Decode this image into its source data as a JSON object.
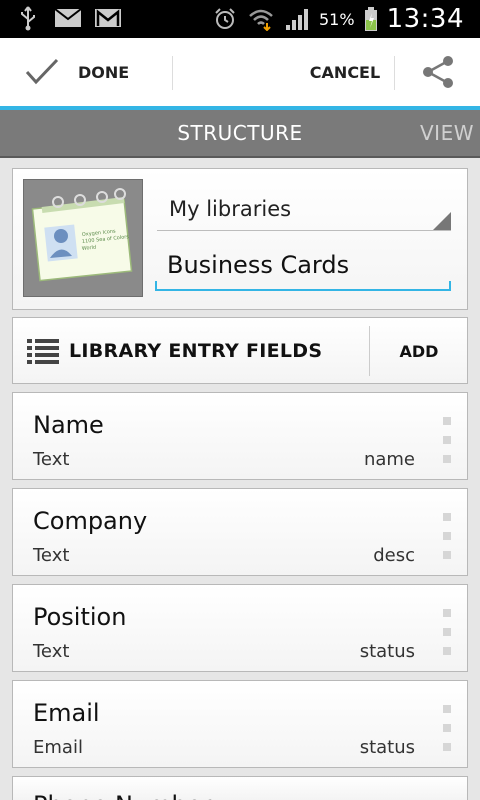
{
  "status_bar": {
    "icons": [
      "usb-icon",
      "mail-icon",
      "gmail-icon",
      "alarm-icon",
      "wifi-icon",
      "signal-icon",
      "battery-icon"
    ],
    "battery": "51%",
    "time": "13:34"
  },
  "action_bar": {
    "done_label": "DONE",
    "cancel_label": "CANCEL",
    "accent_color": "#33b5e5"
  },
  "tabs": {
    "structure": "STRUCTURE",
    "view": "VIEW"
  },
  "library": {
    "selected": "My libraries",
    "name_value": "Business Cards",
    "thumbnail_text": "Oxygen Icons 1100 Sea of Colors World"
  },
  "fields_header": {
    "title": "LIBRARY ENTRY FIELDS",
    "add_label": "ADD"
  },
  "fields": [
    {
      "name": "Name",
      "type": "Text",
      "key": "name"
    },
    {
      "name": "Company",
      "type": "Text",
      "key": "desc"
    },
    {
      "name": "Position",
      "type": "Text",
      "key": "status"
    },
    {
      "name": "Email",
      "type": "Email",
      "key": "status"
    },
    {
      "name": "Phone Number",
      "type": "",
      "key": ""
    }
  ]
}
